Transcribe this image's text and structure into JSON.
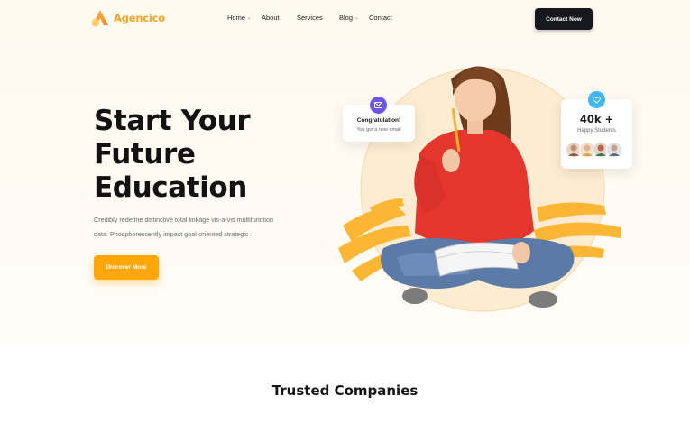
{
  "brand": {
    "name": "Agencico",
    "color": "#f5a524"
  },
  "nav": {
    "items": [
      {
        "label": "Home",
        "has_dropdown": true
      },
      {
        "label": "About",
        "has_dropdown": false
      },
      {
        "label": "Services",
        "has_dropdown": false
      },
      {
        "label": "Blog",
        "has_dropdown": true
      },
      {
        "label": "Contact",
        "has_dropdown": false
      }
    ],
    "cta_label": "Contact Now"
  },
  "hero": {
    "title_lines": [
      "Start Your",
      "Future",
      "Education"
    ],
    "description_lines": [
      "Credibly redefine distinctive total linkage vis-a-vis multifunction",
      "data. Phosphorescently impact goal-oriented strategic"
    ],
    "button_label": "Discover More",
    "accent_color": "#ffa709"
  },
  "cards": {
    "congrats": {
      "title": "Congratulation!",
      "subtitle": "You got a new email",
      "icon": "mail-icon",
      "badge_color": "#6b56e8"
    },
    "students": {
      "count": "40k +",
      "subtitle": "Happy Students",
      "icon": "heart-icon",
      "badge_color": "#3fb6f2"
    }
  },
  "sections": {
    "trusted_title": "Trusted Companies"
  }
}
